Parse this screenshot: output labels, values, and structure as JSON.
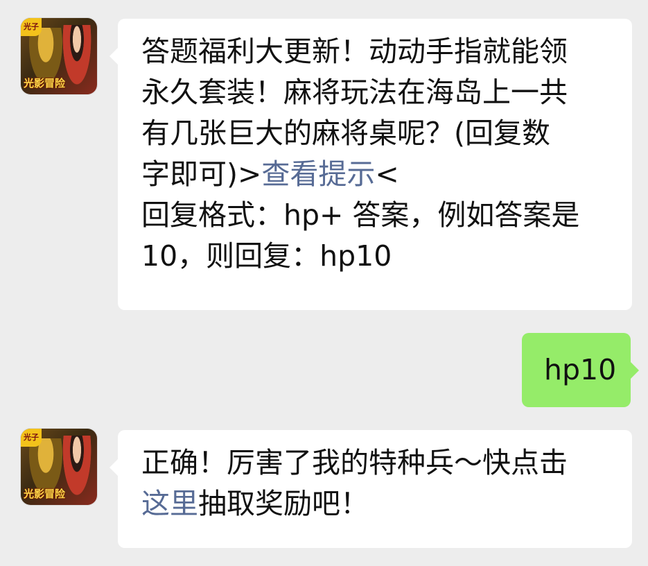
{
  "chat": {
    "messages": [
      {
        "sender": "official-account",
        "avatar_icon": "game-avatar-icon",
        "avatar_badge_top": "光子",
        "avatar_badge_bottom": "光影冒险",
        "lines": [
          "答题福利大更新！动动手指就能领",
          "永久套装！麻将玩法在海岛上一共",
          "有几张巨大的麻将桌呢？(回复数"
        ],
        "line4_prefix": "字即可)>",
        "line4_link": "查看提示",
        "line4_suffix": "<",
        "line5": "回复格式：hp+ 答案，例如答案是",
        "line6": "10，则回复：hp10"
      },
      {
        "sender": "me",
        "text": "hp10"
      },
      {
        "sender": "official-account",
        "avatar_icon": "game-avatar-icon",
        "avatar_badge_top": "光子",
        "avatar_badge_bottom": "光影冒险",
        "line1": "正确！厉害了我的特种兵～快点击",
        "line2_link": "这里",
        "line2_suffix": "抽取奖励吧！"
      }
    ]
  },
  "colors": {
    "background": "#ededed",
    "incoming_bubble": "#ffffff",
    "outgoing_bubble": "#95ec69",
    "link": "#576b95"
  }
}
